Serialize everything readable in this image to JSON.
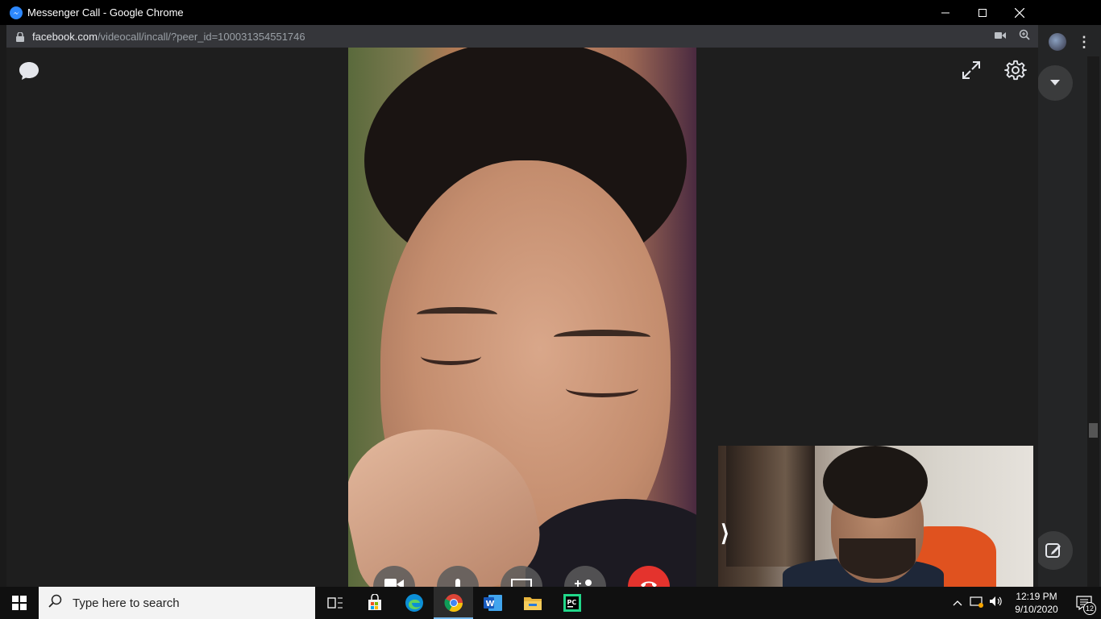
{
  "window": {
    "title": "Messenger Call - Google Chrome",
    "controls": [
      "minimize",
      "maximize",
      "close"
    ]
  },
  "address_bar": {
    "url_host": "facebook.com",
    "url_path": "/videocall/incall/?peer_id=100031354551746",
    "icons": [
      "lock-icon",
      "camera-icon",
      "zoom-icon"
    ]
  },
  "call": {
    "top_left_icons": [
      "chat-bubble-icon"
    ],
    "top_right_icons": [
      "expand-icon",
      "settings-gear-icon"
    ],
    "controls": [
      "video-camera-icon",
      "microphone-icon",
      "screen-share-icon",
      "add-person-icon",
      "end-call-icon"
    ],
    "colors": {
      "end_call": "#e4332d",
      "background": "#1e1e1e"
    }
  },
  "taskbar": {
    "search_placeholder": "Type here to search",
    "apps": [
      "task-view-icon",
      "store-icon",
      "edge-icon",
      "chrome-icon",
      "word-icon",
      "file-explorer-icon",
      "pycharm-icon"
    ],
    "active_app": "chrome-icon",
    "clock_time": "12:19 PM",
    "clock_date": "9/10/2020",
    "notification_count": "12"
  }
}
